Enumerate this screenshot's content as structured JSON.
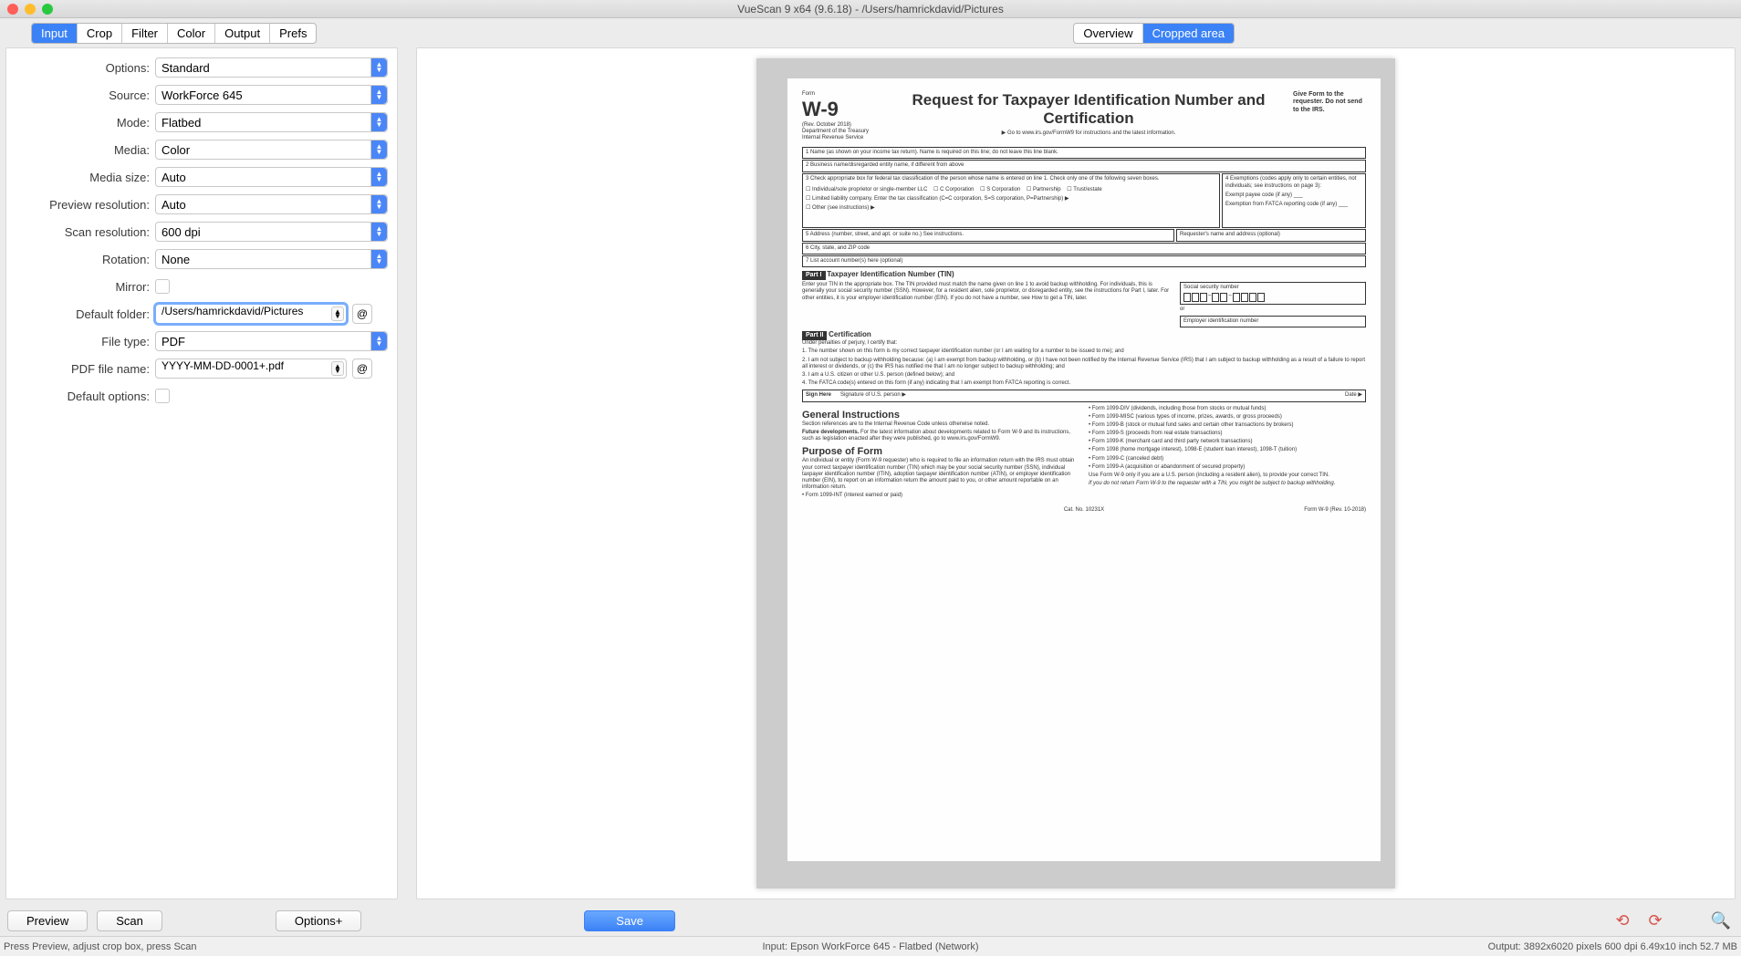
{
  "titlebar": {
    "title": "VueScan 9 x64 (9.6.18) - /Users/hamrickdavid/Pictures"
  },
  "main_tabs": [
    "Input",
    "Crop",
    "Filter",
    "Color",
    "Output",
    "Prefs"
  ],
  "main_tabs_active": 0,
  "preview_tabs": [
    "Overview",
    "Cropped area"
  ],
  "preview_tabs_active": 1,
  "form": {
    "options": {
      "label": "Options:",
      "value": "Standard"
    },
    "source": {
      "label": "Source:",
      "value": "WorkForce 645"
    },
    "mode": {
      "label": "Mode:",
      "value": "Flatbed"
    },
    "media": {
      "label": "Media:",
      "value": "Color"
    },
    "media_size": {
      "label": "Media size:",
      "value": "Auto"
    },
    "preview_res": {
      "label": "Preview resolution:",
      "value": "Auto"
    },
    "scan_res": {
      "label": "Scan resolution:",
      "value": "600 dpi"
    },
    "rotation": {
      "label": "Rotation:",
      "value": "None"
    },
    "mirror": {
      "label": "Mirror:"
    },
    "default_folder": {
      "label": "Default folder:",
      "value": "/Users/hamrickdavid/Pictures"
    },
    "file_type": {
      "label": "File type:",
      "value": "PDF"
    },
    "pdf_file_name": {
      "label": "PDF file name:",
      "value": "YYYY-MM-DD-0001+.pdf"
    },
    "default_options": {
      "label": "Default options:"
    }
  },
  "doc_preview": {
    "form_no": "W-9",
    "rev": "(Rev. October 2018)",
    "dept": "Department of the Treasury\nInternal Revenue Service",
    "title": "Request for Taxpayer Identification Number and Certification",
    "goto": "▶ Go to www.irs.gov/FormW9 for instructions and the latest information.",
    "give": "Give Form to the requester. Do not send to the IRS.",
    "line1": "1  Name (as shown on your income tax return). Name is required on this line; do not leave this line blank.",
    "line2": "2  Business name/disregarded entity name, if different from above",
    "line3": "3  Check appropriate box for federal tax classification of the person whose name is entered on line 1. Check only one of the following seven boxes.",
    "line4": "4  Exemptions (codes apply only to certain entities, not individuals; see instructions on page 3):",
    "line5": "5  Address (number, street, and apt. or suite no.) See instructions.",
    "line6": "6  City, state, and ZIP code",
    "line7": "7  List account number(s) here (optional)",
    "requester": "Requester's name and address (optional)",
    "part1": "Part I",
    "part1_title": "Taxpayer Identification Number (TIN)",
    "part1_text": "Enter your TIN in the appropriate box. The TIN provided must match the name given on line 1 to avoid backup withholding. For individuals, this is generally your social security number (SSN). However, for a resident alien, sole proprietor, or disregarded entity, see the instructions for Part I, later. For other entities, it is your employer identification number (EIN). If you do not have a number, see How to get a TIN, later.",
    "ssn": "Social security number",
    "ein": "Employer identification number",
    "or": "or",
    "part2": "Part II",
    "part2_title": "Certification",
    "cert_intro": "Under penalties of perjury, I certify that:",
    "cert_1": "1. The number shown on this form is my correct taxpayer identification number (or I am waiting for a number to be issued to me); and",
    "cert_2": "2. I am not subject to backup withholding because: (a) I am exempt from backup withholding, or (b) I have not been notified by the Internal Revenue Service (IRS) that I am subject to backup withholding as a result of a failure to report all interest or dividends, or (c) the IRS has notified me that I am no longer subject to backup withholding; and",
    "cert_3": "3. I am a U.S. citizen or other U.S. person (defined below); and",
    "cert_4": "4. The FATCA code(s) entered on this form (if any) indicating that I am exempt from FATCA reporting is correct.",
    "gi": "General Instructions",
    "purpose": "Purpose of Form",
    "sign": "Sign Here",
    "sig_of": "Signature of U.S. person ▶",
    "date": "Date ▶",
    "cat": "Cat. No. 10231X",
    "foot": "Form W-9 (Rev. 10-2018)"
  },
  "buttons": {
    "preview": "Preview",
    "scan": "Scan",
    "options_plus": "Options+",
    "save": "Save"
  },
  "at": "@",
  "status": {
    "left": "Press Preview, adjust crop box, press Scan",
    "center": "Input: Epson WorkForce 645 - Flatbed (Network)",
    "right": "Output: 3892x6020 pixels 600 dpi 6.49x10 inch 52.7 MB"
  }
}
